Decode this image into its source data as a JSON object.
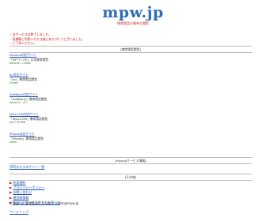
{
  "header": {
    "logo": "mpw.jp",
    "tagline": "携帯電話の簡単な閲覧"
  },
  "notice": {
    "line1": "・当サービスは終了しました。",
    "line2": "・長期間ご利用いただき誠にありがとうございました。",
    "line3": "・ご了承ください。"
  },
  "sections": {
    "mobile": "[携帯電話閲覧]",
    "tools": "[mpw.jpサービス情報]",
    "others": "[その他]"
  },
  "sites": [
    {
      "title": "docomo対応サイト",
      "desc": "「NTTドコモ」公式携帯閲覧",
      "sub": "docomo / i-mode"
    },
    {
      "title": "au対応サイト",
      "desc": "「au」携帯電話閲覧",
      "sub": "EZweb"
    },
    {
      "title": "SoftBank対応サイト",
      "desc": "「SoftBank」携帯電話閲覧",
      "sub": "Yahoo!ケータイ"
    },
    {
      "title": "WILLCOM対応サイト",
      "desc": "「WILLCOM」携帯電話閲覧",
      "sub": "AirH\" PHONE"
    },
    {
      "title": "iPhone対応サイト",
      "desc": "「iPhone」携帯電話閲覧",
      "sub": "Safari"
    }
  ],
  "recommend": {
    "label": "[PR]おすすめサイト一覧"
  },
  "links": [
    "利用規約",
    "プライバシーポリシー",
    "お問い合わせ",
    "運営者情報",
    "mpw.jp サービス終了のお知らせ"
  ],
  "contact": "ご意見・ご要望等はこちらまで → bbs@mpw.jp",
  "pagetop": "ページトップ"
}
